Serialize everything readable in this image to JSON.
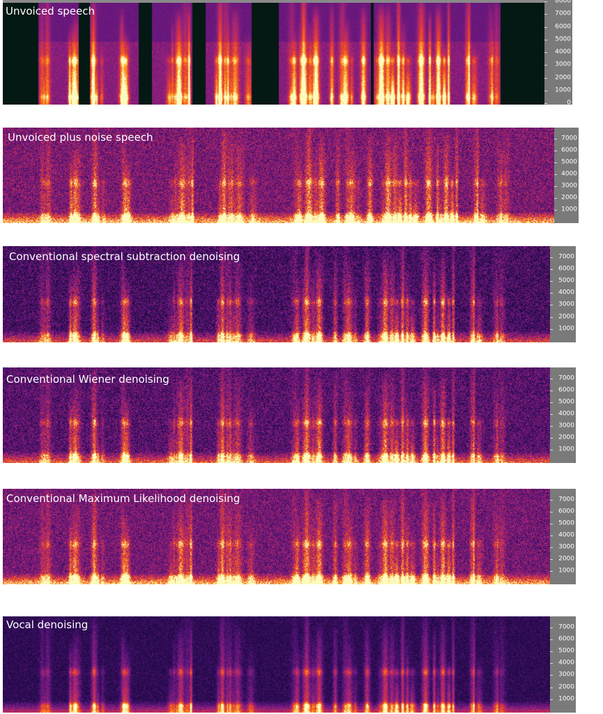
{
  "panels": [
    {
      "id": "unvoiced",
      "title": "Unvoiced speech",
      "ticks": [
        "8000",
        "7000",
        "6000",
        "5000",
        "4000",
        "3000",
        "2000",
        "1000",
        "0"
      ],
      "style": "silence-gaps",
      "top_freq": 8000
    },
    {
      "id": "noisy",
      "title": "Unvoiced plus noise speech",
      "ticks": [
        "7000",
        "6000",
        "5000",
        "4000",
        "3000",
        "2000",
        "1000"
      ],
      "style": "noisy",
      "top_freq": 7800
    },
    {
      "id": "spectral",
      "title": "Conventional spectral subtraction denoising",
      "ticks": [
        "7000",
        "6000",
        "5000",
        "4000",
        "3000",
        "2000",
        "1000"
      ],
      "style": "spectral",
      "top_freq": 7800
    },
    {
      "id": "wiener",
      "title": "Conventional Wiener denoising",
      "ticks": [
        "7000",
        "6000",
        "5000",
        "4000",
        "3000",
        "2000",
        "1000"
      ],
      "style": "wiener",
      "top_freq": 7800
    },
    {
      "id": "ml",
      "title": "Conventional Maximum Likelihood denoising",
      "ticks": [
        "7000",
        "6000",
        "5000",
        "4000",
        "3000",
        "2000",
        "1000"
      ],
      "style": "ml",
      "top_freq": 7800
    },
    {
      "id": "vocal",
      "title": "Vocal denoising",
      "ticks": [
        "7000",
        "6000",
        "5000",
        "4000",
        "3000",
        "2000",
        "1000"
      ],
      "style": "vocal",
      "top_freq": 7800
    }
  ]
}
